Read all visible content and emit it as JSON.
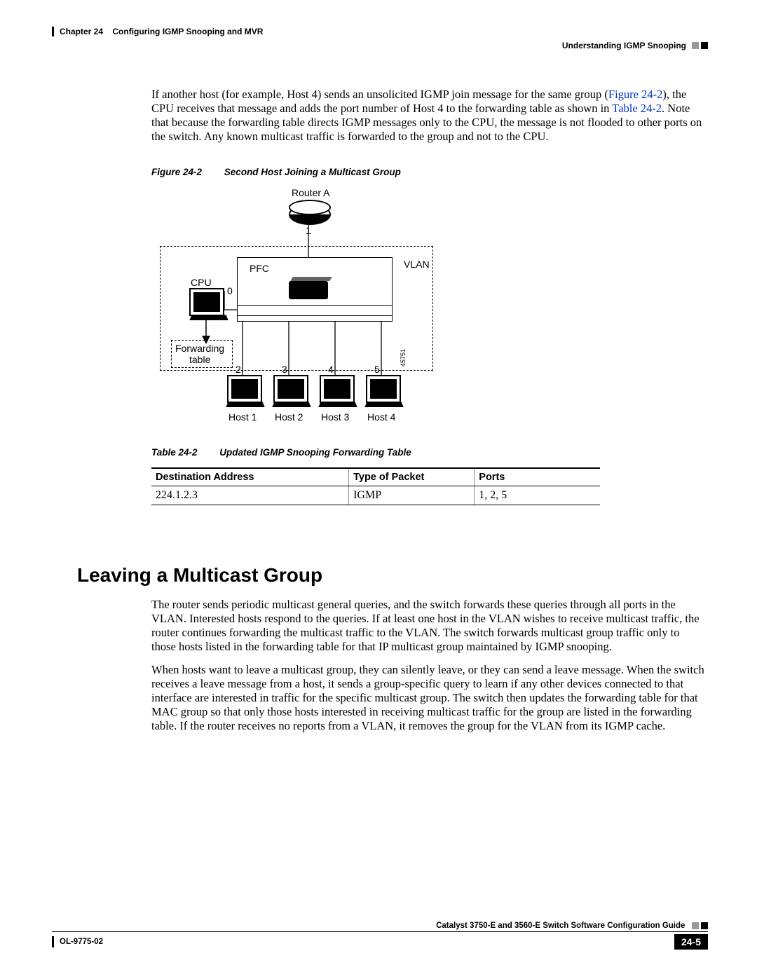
{
  "header": {
    "chapter_label": "Chapter 24",
    "chapter_title": "Configuring IGMP Snooping and MVR",
    "section_right": "Understanding IGMP Snooping"
  },
  "intro": {
    "p1a": "If another host (for example, Host 4) sends an unsolicited IGMP join message for the same group (",
    "fig_ref": "Figure 24-2",
    "p1b": "), the CPU receives that message and adds the port number of Host 4 to the forwarding table as shown in ",
    "tbl_ref": "Table 24-2",
    "p1c": ". Note that because the forwarding table directs IGMP messages only to the CPU, the message is not flooded to other ports on the switch. Any known multicast traffic is forwarded to the group and not to the CPU."
  },
  "figure": {
    "label": "Figure 24-2",
    "title": "Second Host Joining a Multicast Group",
    "labels": {
      "router": "Router A",
      "vlan": "VLAN",
      "cpu": "CPU",
      "pfc": "PFC",
      "fwd1": "Forwarding",
      "fwd2": "table",
      "ports": {
        "p0": "0",
        "p1": "1",
        "p2": "2",
        "p3": "3",
        "p4": "4",
        "p5": "5"
      },
      "hosts": {
        "h1": "Host 1",
        "h2": "Host 2",
        "h3": "Host 3",
        "h4": "Host 4"
      },
      "diagid": "45751"
    }
  },
  "table": {
    "label": "Table 24-2",
    "title": "Updated IGMP Snooping Forwarding Table",
    "headers": {
      "c1": "Destination Address",
      "c2": "Type of Packet",
      "c3": "Ports"
    },
    "row": {
      "c1": "224.1.2.3",
      "c2": "IGMP",
      "c3": "1, 2, 5"
    }
  },
  "section2": {
    "title": "Leaving a Multicast Group",
    "p1": "The router sends periodic multicast general queries, and the switch forwards these queries through all ports in the VLAN. Interested hosts respond to the queries. If at least one host in the VLAN wishes to receive multicast traffic, the router continues forwarding the multicast traffic to the VLAN. The switch forwards multicast group traffic only to those hosts listed in the forwarding table for that IP multicast group maintained by IGMP snooping.",
    "p2": "When hosts want to leave a multicast group, they can silently leave, or they can send a leave message. When the switch receives a leave message from a host, it sends a group-specific query to learn if any other devices connected to that interface are interested in traffic for the specific multicast group. The switch then updates the forwarding table for that MAC group so that only those hosts interested in receiving multicast traffic for the group are listed in the forwarding table. If the router receives no reports from a VLAN, it removes the group for the VLAN from its IGMP cache."
  },
  "footer": {
    "guide": "Catalyst 3750-E and 3560-E Switch Software Configuration Guide",
    "docid": "OL-9775-02",
    "page": "24-5"
  }
}
